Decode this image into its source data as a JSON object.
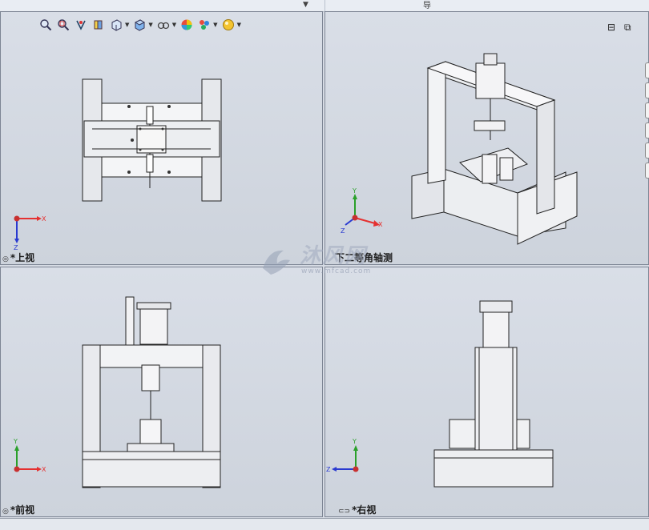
{
  "top_strip": {
    "hint": "导"
  },
  "toolbar": {
    "buttons": [
      {
        "icon": "zoom-to-fit-icon"
      },
      {
        "icon": "zoom-to-area-icon"
      },
      {
        "icon": "previous-view-icon"
      },
      {
        "icon": "section-view-icon"
      },
      {
        "icon": "view-orientation-icon"
      },
      {
        "icon": "display-style-icon"
      },
      {
        "icon": "hide-show-items-icon"
      },
      {
        "icon": "edit-appearance-icon"
      },
      {
        "icon": "apply-scene-icon"
      },
      {
        "icon": "view-settings-icon"
      }
    ]
  },
  "window_controls": {
    "restore": "⊟",
    "maximize": "⧉"
  },
  "viewports": {
    "top": {
      "label": "*上视"
    },
    "iso": {
      "label": "下二等角轴测"
    },
    "front": {
      "label": "*前视"
    },
    "right": {
      "label": "*右视"
    }
  },
  "triad": {
    "x": "X",
    "y": "Y",
    "z": "Z"
  },
  "watermark": {
    "text": "沐风网",
    "url": "www.mfcad.com"
  },
  "colors": {
    "axis_x": "#e53030",
    "axis_y": "#2aa02a",
    "axis_z": "#2a3ad0",
    "viewport_bg": "#d3d8e0"
  }
}
